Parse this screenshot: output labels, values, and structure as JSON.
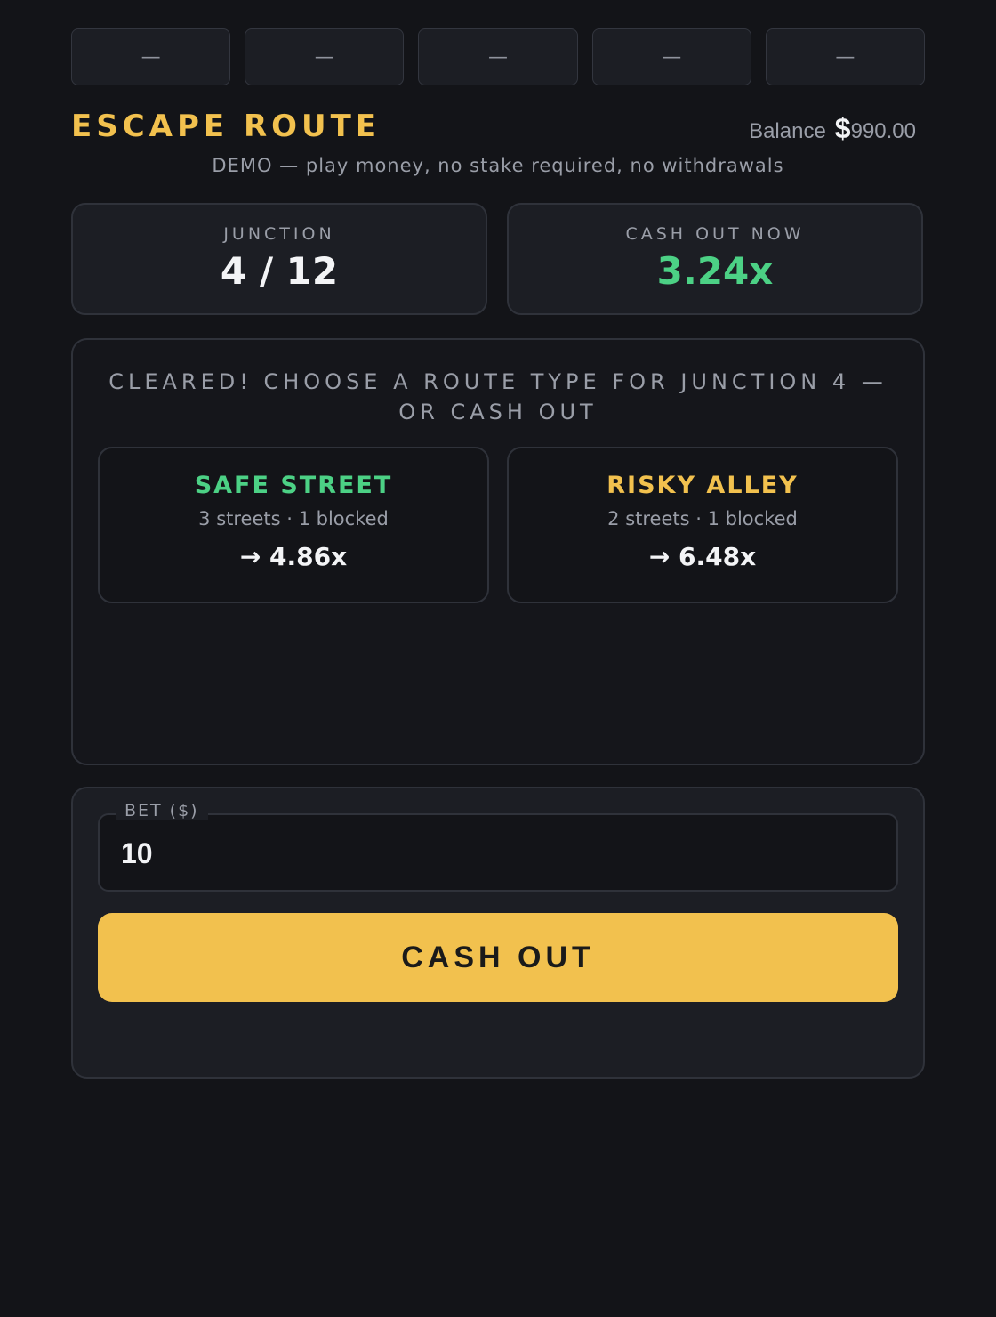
{
  "top_slots": [
    "—",
    "—",
    "—",
    "—",
    "—"
  ],
  "header": {
    "title": "ESCAPE ROUTE",
    "balance_label": "Balance",
    "balance_currency": "$",
    "balance_amount": "990.00",
    "demo_notice": "DEMO — play money, no stake required, no withdrawals"
  },
  "stats": {
    "junction_label": "JUNCTION",
    "junction_value": "4 / 12",
    "cashout_label": "CASH OUT NOW",
    "cashout_value": "3.24x"
  },
  "board": {
    "prompt": "CLEARED! CHOOSE A ROUTE TYPE FOR JUNCTION 4 — OR CASH OUT",
    "routes": [
      {
        "name": "SAFE STREET",
        "info": "3 streets · 1 blocked",
        "multiplier": "→ 4.86x",
        "color": "#4cd185"
      },
      {
        "name": "RISKY ALLEY",
        "info": "2 streets · 1 blocked",
        "multiplier": "→ 6.48x",
        "color": "#f2c14e"
      }
    ]
  },
  "controls": {
    "bet_label": "BET ($)",
    "bet_value": "10",
    "cashout_button": "CASH OUT"
  },
  "colors": {
    "accent": "#f2c14e",
    "success": "#4cd185",
    "background": "#131418",
    "panel": "#1c1e24"
  }
}
